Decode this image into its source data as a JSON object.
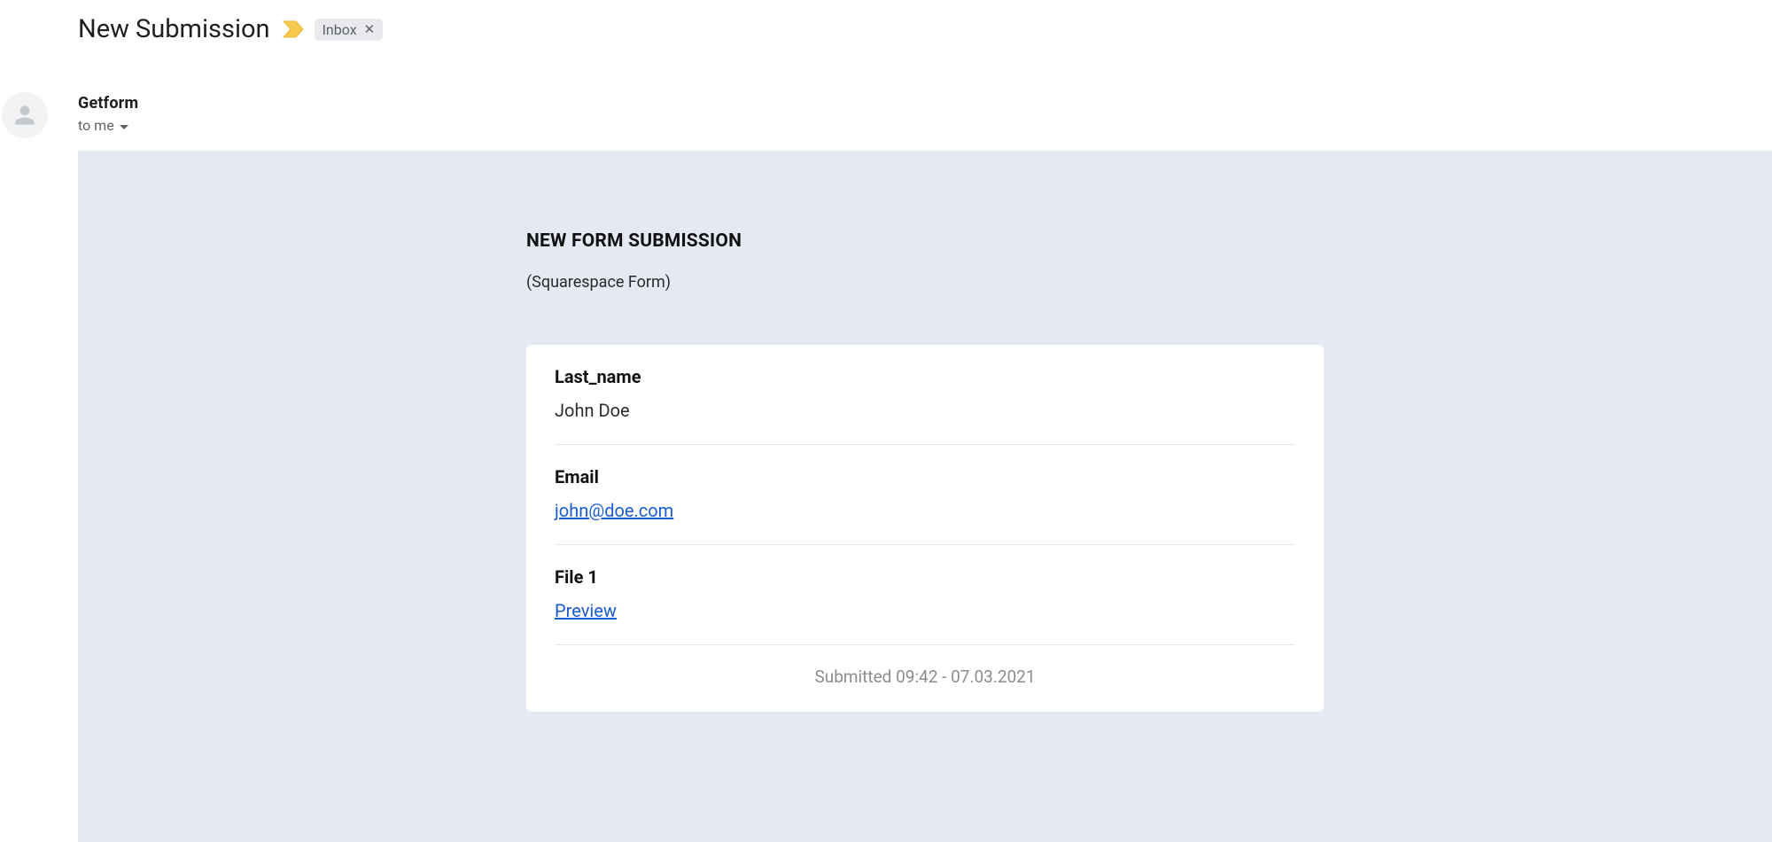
{
  "header": {
    "subject": "New Submission",
    "label": "Inbox"
  },
  "sender": {
    "name": "Getform",
    "to_line": "to me"
  },
  "body": {
    "heading": "NEW FORM SUBMISSION",
    "subheading": "(Squarespace Form)",
    "fields": [
      {
        "label": "Last_name",
        "value": "John Doe",
        "is_link": false
      },
      {
        "label": "Email",
        "value": "john@doe.com",
        "is_link": true
      },
      {
        "label": "File 1",
        "value": "Preview",
        "is_link": true
      }
    ],
    "timestamp": "Submitted 09:42 - 07.03.2021"
  }
}
